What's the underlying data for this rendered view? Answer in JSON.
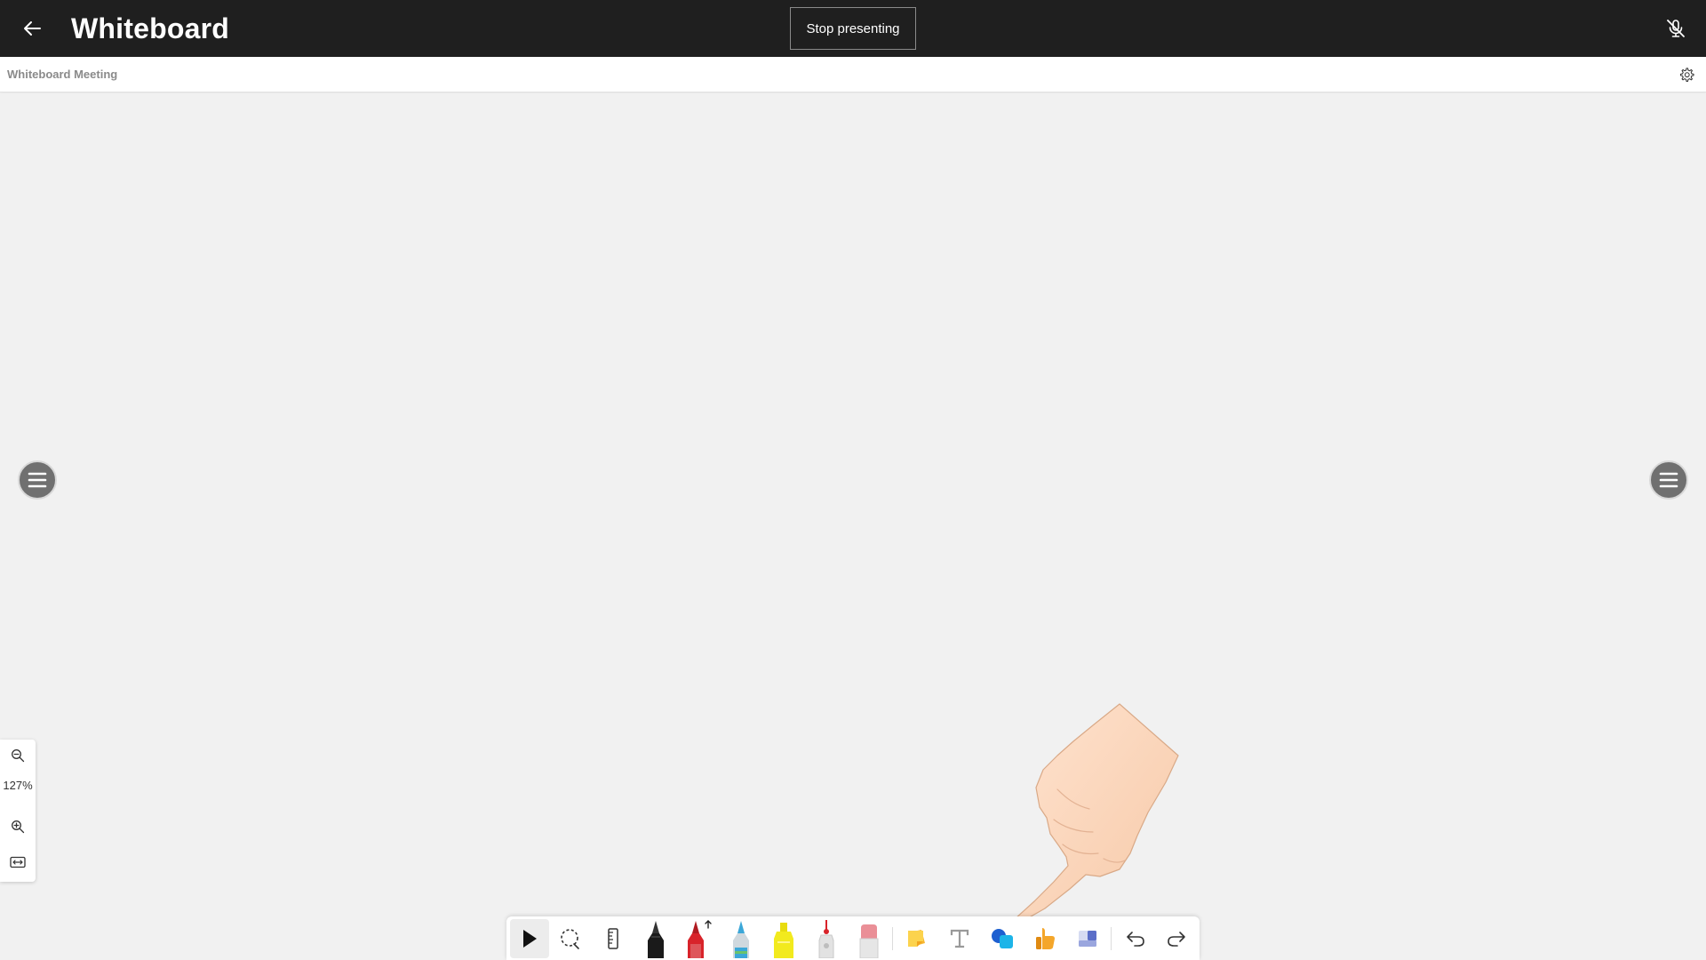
{
  "app": {
    "title": "Whiteboard",
    "stop_presenting_label": "Stop presenting"
  },
  "meeting": {
    "title": "Whiteboard Meeting"
  },
  "zoom": {
    "level": "127%"
  },
  "toolbar": {
    "tools": [
      {
        "name": "select",
        "icon": "cursor-arrow-icon",
        "active": true
      },
      {
        "name": "lasso",
        "icon": "lasso-icon"
      },
      {
        "name": "ruler",
        "icon": "ruler-icon"
      },
      {
        "name": "pen-black",
        "icon": "pen-icon",
        "color": "#1a1a1a"
      },
      {
        "name": "pen-red",
        "icon": "pen-icon",
        "color": "#d8232a"
      },
      {
        "name": "pen-rainbow",
        "icon": "pen-icon",
        "color": "#3ba7d8"
      },
      {
        "name": "highlighter",
        "icon": "highlighter-icon",
        "color": "#f2ea1e"
      },
      {
        "name": "laser-pointer",
        "icon": "laser-pointer-icon",
        "color": "#d8232a"
      },
      {
        "name": "eraser",
        "icon": "eraser-icon",
        "color": "#ea8f97"
      },
      {
        "name": "sticky-note",
        "icon": "sticky-note-icon",
        "color": "#f7b733"
      },
      {
        "name": "text",
        "icon": "text-icon"
      },
      {
        "name": "shapes",
        "icon": "shapes-icon",
        "color": "#1d7ddc"
      },
      {
        "name": "reactions",
        "icon": "thumbs-up-icon",
        "color": "#f4a62a"
      },
      {
        "name": "templates",
        "icon": "templates-icon",
        "color": "#5b6ec8"
      },
      {
        "name": "undo",
        "icon": "undo-icon"
      },
      {
        "name": "redo",
        "icon": "redo-icon"
      }
    ]
  },
  "colors": {
    "topbar": "#1f1f1f",
    "canvas": "#f1f1f1",
    "accent": "#1d7ddc"
  }
}
